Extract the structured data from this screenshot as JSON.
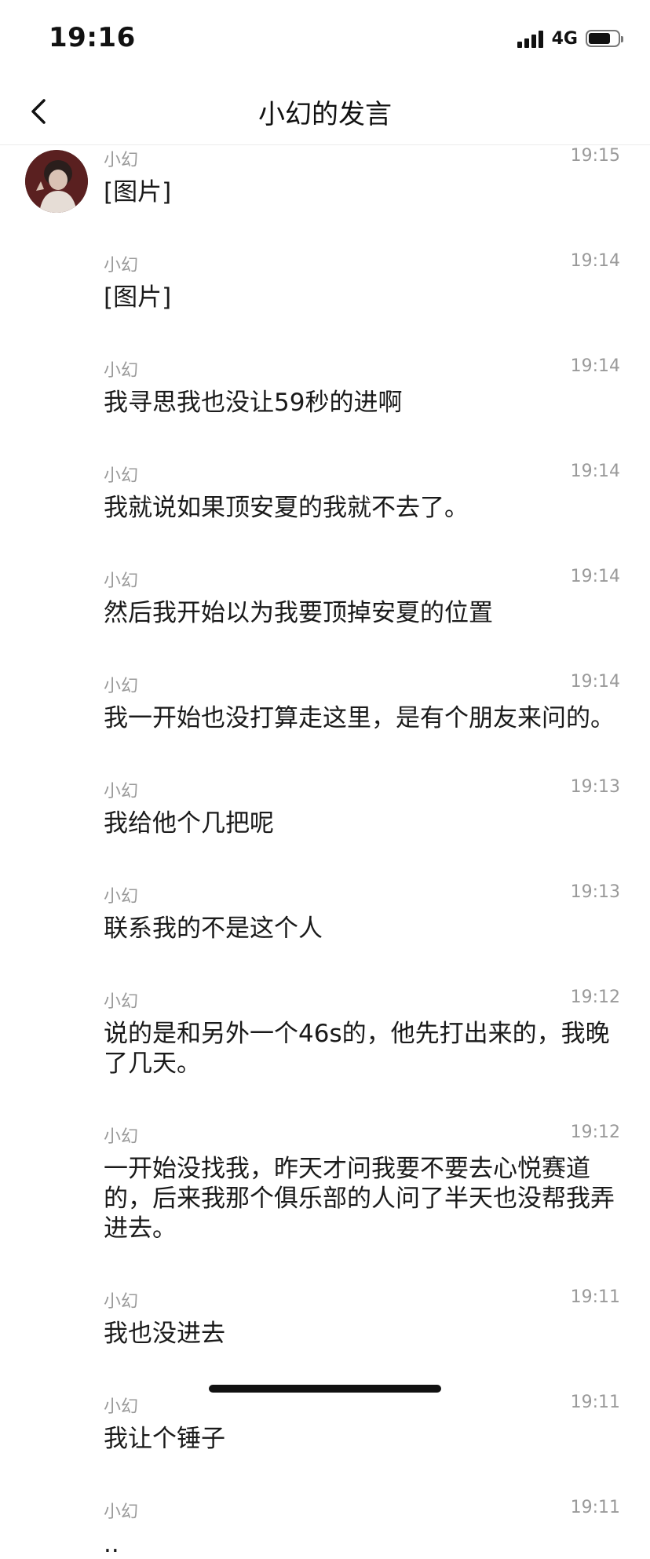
{
  "status_bar": {
    "time": "19:16",
    "network": "4G",
    "battery_level": 0.75
  },
  "nav": {
    "title": "小幻的发言",
    "back_icon": "chevron-left-icon"
  },
  "messages": [
    {
      "sender": "小幻",
      "time": "19:15",
      "text": "[图片]"
    },
    {
      "sender": "小幻",
      "time": "19:14",
      "text": "[图片]"
    },
    {
      "sender": "小幻",
      "time": "19:14",
      "text": "我寻思我也没让59秒的进啊"
    },
    {
      "sender": "小幻",
      "time": "19:14",
      "text": "我就说如果顶安夏的我就不去了。"
    },
    {
      "sender": "小幻",
      "time": "19:14",
      "text": "然后我开始以为我要顶掉安夏的位置"
    },
    {
      "sender": "小幻",
      "time": "19:14",
      "text": "我一开始也没打算走这里，是有个朋友来问的。"
    },
    {
      "sender": "小幻",
      "time": "19:13",
      "text": "我给他个几把呢"
    },
    {
      "sender": "小幻",
      "time": "19:13",
      "text": "联系我的不是这个人"
    },
    {
      "sender": "小幻",
      "time": "19:12",
      "text": "说的是和另外一个46s的，他先打出来的，我晚了几天。"
    },
    {
      "sender": "小幻",
      "time": "19:12",
      "text": "一开始没找我，昨天才问我要不要去心悦赛道的，后来我那个俱乐部的人问了半天也没帮我弄进去。"
    },
    {
      "sender": "小幻",
      "time": "19:11",
      "text": "我也没进去"
    },
    {
      "sender": "小幻",
      "time": "19:11",
      "text": "我让个锤子"
    },
    {
      "sender": "小幻",
      "time": "19:11",
      "text": ".."
    }
  ]
}
